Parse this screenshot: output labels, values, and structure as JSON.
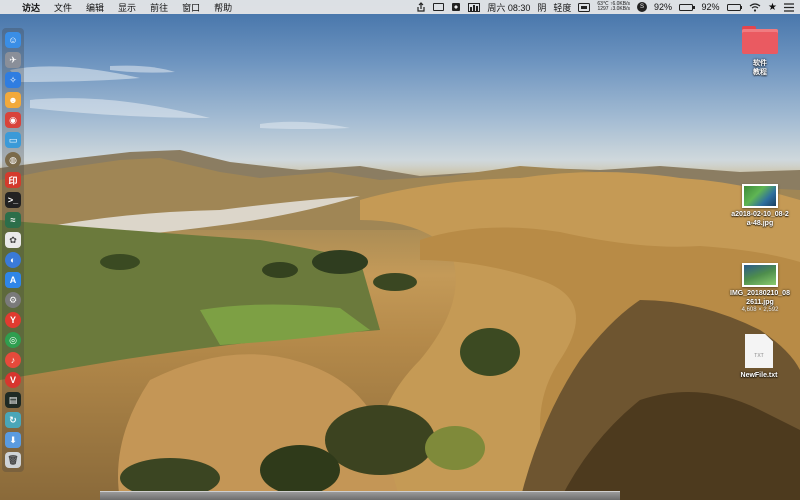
{
  "menubar": {
    "apple_glyph": "",
    "app_name": "访达",
    "menus": [
      "文件",
      "编辑",
      "显示",
      "前往",
      "窗口",
      "帮助"
    ],
    "clock": "周六 08:30",
    "weather": "阴",
    "air_quality": "轻度",
    "temperature": "63℃",
    "net_down": "↑6.0KB/s",
    "net_counter": "1297",
    "net_up": "↓3.0KB/s",
    "battery_percent_1": "92%",
    "battery_percent_2": "92%",
    "battery_level": 0.92,
    "icons": [
      "share-icon",
      "display-icon",
      "vpn-icon",
      "network-monitor-icon",
      "battery-icon",
      "wifi-icon",
      "star-icon",
      "control-center-icon"
    ]
  },
  "dock": {
    "items": [
      {
        "name": "finder-icon",
        "color": "#3a8ee6",
        "glyph": "☺"
      },
      {
        "name": "launchpad-icon",
        "color": "#8a8f99",
        "glyph": "✈"
      },
      {
        "name": "safari-icon",
        "color": "#2f7de1",
        "glyph": "✧"
      },
      {
        "name": "contacts-icon",
        "color": "#f2a93b",
        "glyph": "☻"
      },
      {
        "name": "app-red-icon",
        "color": "#d8433b",
        "glyph": "◉"
      },
      {
        "name": "preview-icon",
        "color": "#3b9ad8",
        "glyph": "▭"
      },
      {
        "name": "globe-icon",
        "color": "#7a6a4a",
        "glyph": "◍"
      },
      {
        "name": "app-pinyin-icon",
        "color": "#d33a2c",
        "glyph": "印"
      },
      {
        "name": "terminal-icon",
        "color": "#222222",
        "glyph": ">_"
      },
      {
        "name": "activity-monitor-icon",
        "color": "#2c6e4a",
        "glyph": "≈"
      },
      {
        "name": "photos-icon",
        "color": "#e9e9e9",
        "glyph": "✿"
      },
      {
        "name": "voice-icon",
        "color": "#3a7ad8",
        "glyph": "◐"
      },
      {
        "name": "app-store-icon",
        "color": "#2f86e8",
        "glyph": "A"
      },
      {
        "name": "system-preferences-icon",
        "color": "#7a7a7a",
        "glyph": "⚙"
      },
      {
        "name": "yandex-browser-icon",
        "color": "#e03b30",
        "glyph": "Y"
      },
      {
        "name": "chrome-icon",
        "color": "#2f9e4f",
        "glyph": "◎"
      },
      {
        "name": "music-app-icon",
        "color": "#e64a3b",
        "glyph": "♪"
      },
      {
        "name": "vivaldi-icon",
        "color": "#d7362e",
        "glyph": "V"
      },
      {
        "name": "dark-app-icon",
        "color": "#1f2a24",
        "glyph": "▤"
      },
      {
        "name": "sync-app-icon",
        "color": "#4aa6b8",
        "glyph": "↻"
      },
      {
        "name": "downloads-folder-icon",
        "color": "#5a9be0",
        "glyph": "⬇"
      },
      {
        "name": "trash-icon",
        "color": "#cfd3d6",
        "glyph": "🗑"
      }
    ]
  },
  "desktop": {
    "folder_label_1": "软件",
    "folder_label_2": "教程",
    "image1_name_1": "a2018-02-10_08-2",
    "image1_name_2": "a-48.jpg",
    "image2_name_1": "IMG_20180210_08",
    "image2_name_2": "2611.jpg",
    "image2_dims": "4,608 × 2,592",
    "txt_badge": "TXT",
    "txt_name": "NewFile.txt"
  },
  "colors": {
    "menubar_bg": "#e8e8e8",
    "folder_red": "#ea5a61",
    "sky_top": "#3f6fa6",
    "hills": "#c49a58"
  }
}
